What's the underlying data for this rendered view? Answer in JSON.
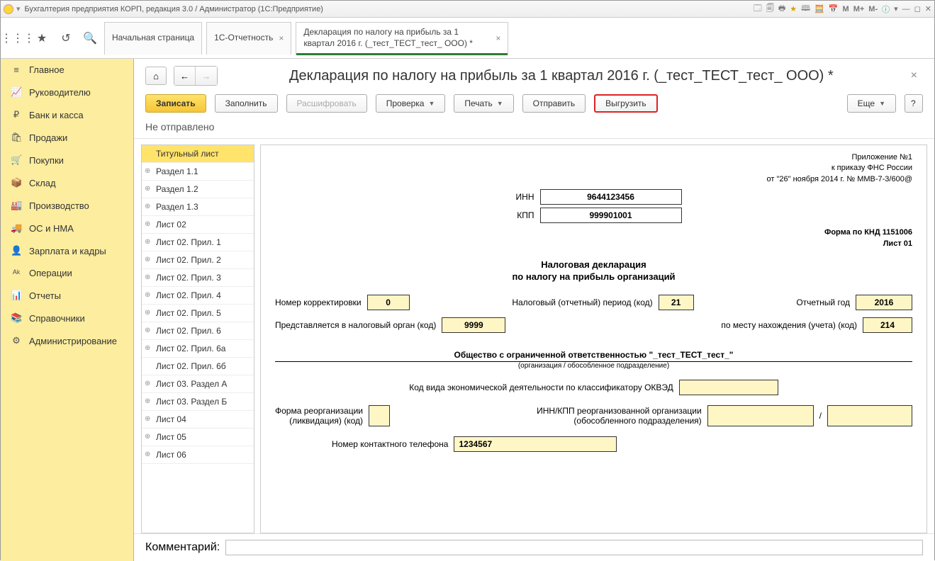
{
  "window": {
    "title": "Бухгалтерия предприятия КОРП, редакция 3.0 / Администратор  (1С:Предприятие)"
  },
  "tabs": {
    "home": "Начальная страница",
    "t1": "1С-Отчетность",
    "t2": "Декларация по налогу на прибыль за 1 квартал 2016 г. (_тест_ТЕСТ_тест_ ООО) *"
  },
  "sidebar": [
    {
      "icon": "≡",
      "label": "Главное"
    },
    {
      "icon": "📈",
      "label": "Руководителю"
    },
    {
      "icon": "₽",
      "label": "Банк и касса"
    },
    {
      "icon": "🛍",
      "label": "Продажи"
    },
    {
      "icon": "🛒",
      "label": "Покупки"
    },
    {
      "icon": "📦",
      "label": "Склад"
    },
    {
      "icon": "🏭",
      "label": "Производство"
    },
    {
      "icon": "🚚",
      "label": "ОС и НМА"
    },
    {
      "icon": "👤",
      "label": "Зарплата и кадры"
    },
    {
      "icon": "ᴬᵏ",
      "label": "Операции"
    },
    {
      "icon": "📊",
      "label": "Отчеты"
    },
    {
      "icon": "📚",
      "label": "Справочники"
    },
    {
      "icon": "⚙",
      "label": "Администрирование"
    }
  ],
  "doc": {
    "title": "Декларация по налогу на прибыль за 1 квартал 2016 г. (_тест_ТЕСТ_тест_ ООО) *",
    "toolbar": {
      "write": "Записать",
      "fill": "Заполнить",
      "decipher": "Расшифровать",
      "check": "Проверка",
      "print": "Печать",
      "send": "Отправить",
      "export": "Выгрузить",
      "more": "Еще",
      "help": "?"
    },
    "status": "Не отправлено",
    "comment_label": "Комментарий:"
  },
  "tree": [
    "Титульный лист",
    "Раздел 1.1",
    "Раздел 1.2",
    "Раздел 1.3",
    "Лист 02",
    "Лист 02. Прил. 1",
    "Лист 02. Прил. 2",
    "Лист 02. Прил. 3",
    "Лист 02. Прил. 4",
    "Лист 02. Прил. 5",
    "Лист 02. Прил. 6",
    "Лист 02. Прил. 6а",
    "Лист 02. Прил. 6б",
    "Лист 03. Раздел А",
    "Лист 03. Раздел Б",
    "Лист 04",
    "Лист 05",
    "Лист 06"
  ],
  "form": {
    "appendix": "Приложение №1",
    "order": "к приказу ФНС России",
    "order2": "от \"26\" ноября 2014 г. № ММВ-7-3/600@",
    "inn_label": "ИНН",
    "inn": "9644123456",
    "kpp_label": "КПП",
    "kpp": "999901001",
    "formcode": "Форма по КНД 1151006",
    "sheet": "Лист 01",
    "title1": "Налоговая декларация",
    "title2": "по налогу на прибыль организаций",
    "corr_label": "Номер корректировки",
    "corr": "0",
    "period_label": "Налоговый (отчетный) период (код)",
    "period": "21",
    "year_label": "Отчетный год",
    "year": "2016",
    "authority_label": "Представляется в налоговый орган (код)",
    "authority": "9999",
    "place_label": "по месту нахождения (учета) (код)",
    "place": "214",
    "orgname": "Общество с ограниченной ответственностью \"_тест_ТЕСТ_тест_\"",
    "orgcap": "(организация / обособленное подразделение)",
    "okved_label": "Код вида экономической деятельности по классификатору ОКВЭД",
    "reorg_label1": "Форма реорганизации",
    "reorg_label2": "(ликвидация) (код)",
    "reorg_inn_label1": "ИНН/КПП реорганизованной организации",
    "reorg_inn_label2": "(обособленного подразделения)",
    "sep": "/",
    "phone_label": "Номер контактного телефона",
    "phone": "1234567"
  }
}
